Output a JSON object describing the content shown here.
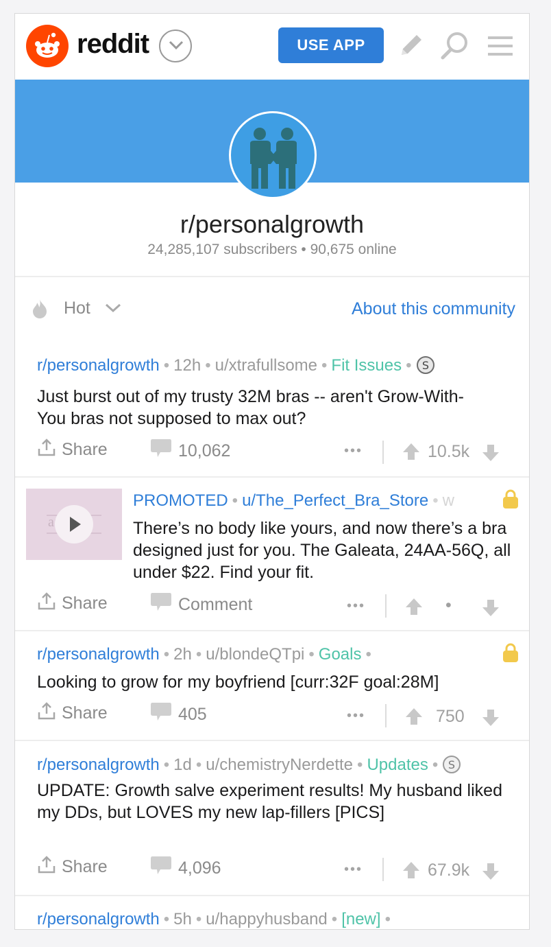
{
  "header": {
    "brand": "reddit",
    "use_app_label": "USE APP",
    "icons": [
      "reddit-alien-logo",
      "chevron-down-icon",
      "pencil-icon",
      "search-icon",
      "menu-icon"
    ],
    "accent_color": "#2f7ed8",
    "logo_color": "#ff4500"
  },
  "subreddit": {
    "name": "r/personalgrowth",
    "stats": "24,285,107 subscribers • 90,675 online",
    "banner_color": "#4a9fe6"
  },
  "sort": {
    "label": "Hot",
    "about_label": "About this community"
  },
  "posts": [
    {
      "subreddit": "r/personalgrowth",
      "age": "12h",
      "author": "u/xtrafullsome",
      "flair": "Fit Issues",
      "title": "Just burst out of my trusty 32M bras -- aren't Grow-With-You bras not supposed to max out?",
      "share_label": "Share",
      "comments": "10,062",
      "score": "10.5k"
    },
    {
      "promoted_label": "PROMOTED",
      "author": "u/The_Perfect_Bra_Store",
      "trailing": "w",
      "thumb_text": "auden.",
      "title": "There’s no body like yours, and now there’s a bra designed just for you. The Galeata, 24AA-56Q, all under $22. Find your fit.",
      "share_label": "Share",
      "comment_label": "Comment",
      "score": "•"
    },
    {
      "subreddit": "r/personalgrowth",
      "age": "2h",
      "author": "u/blondeQTpi",
      "flair": "Goals",
      "title": "Looking to grow for my boyfriend [curr:32F goal:28M]",
      "share_label": "Share",
      "comments": "405",
      "score": "750"
    },
    {
      "subreddit": "r/personalgrowth",
      "age": "1d",
      "author": "u/chemistryNerdette",
      "flair": "Updates",
      "title": "UPDATE: Growth salve experiment results! My husband liked my DDs, but LOVES my new lap-fillers [PICS]",
      "share_label": "Share",
      "comments": "4,096",
      "score": "67.9k"
    },
    {
      "subreddit": "r/personalgrowth",
      "age": "5h",
      "author": "u/happyhusband",
      "flair": "[new]"
    }
  ]
}
